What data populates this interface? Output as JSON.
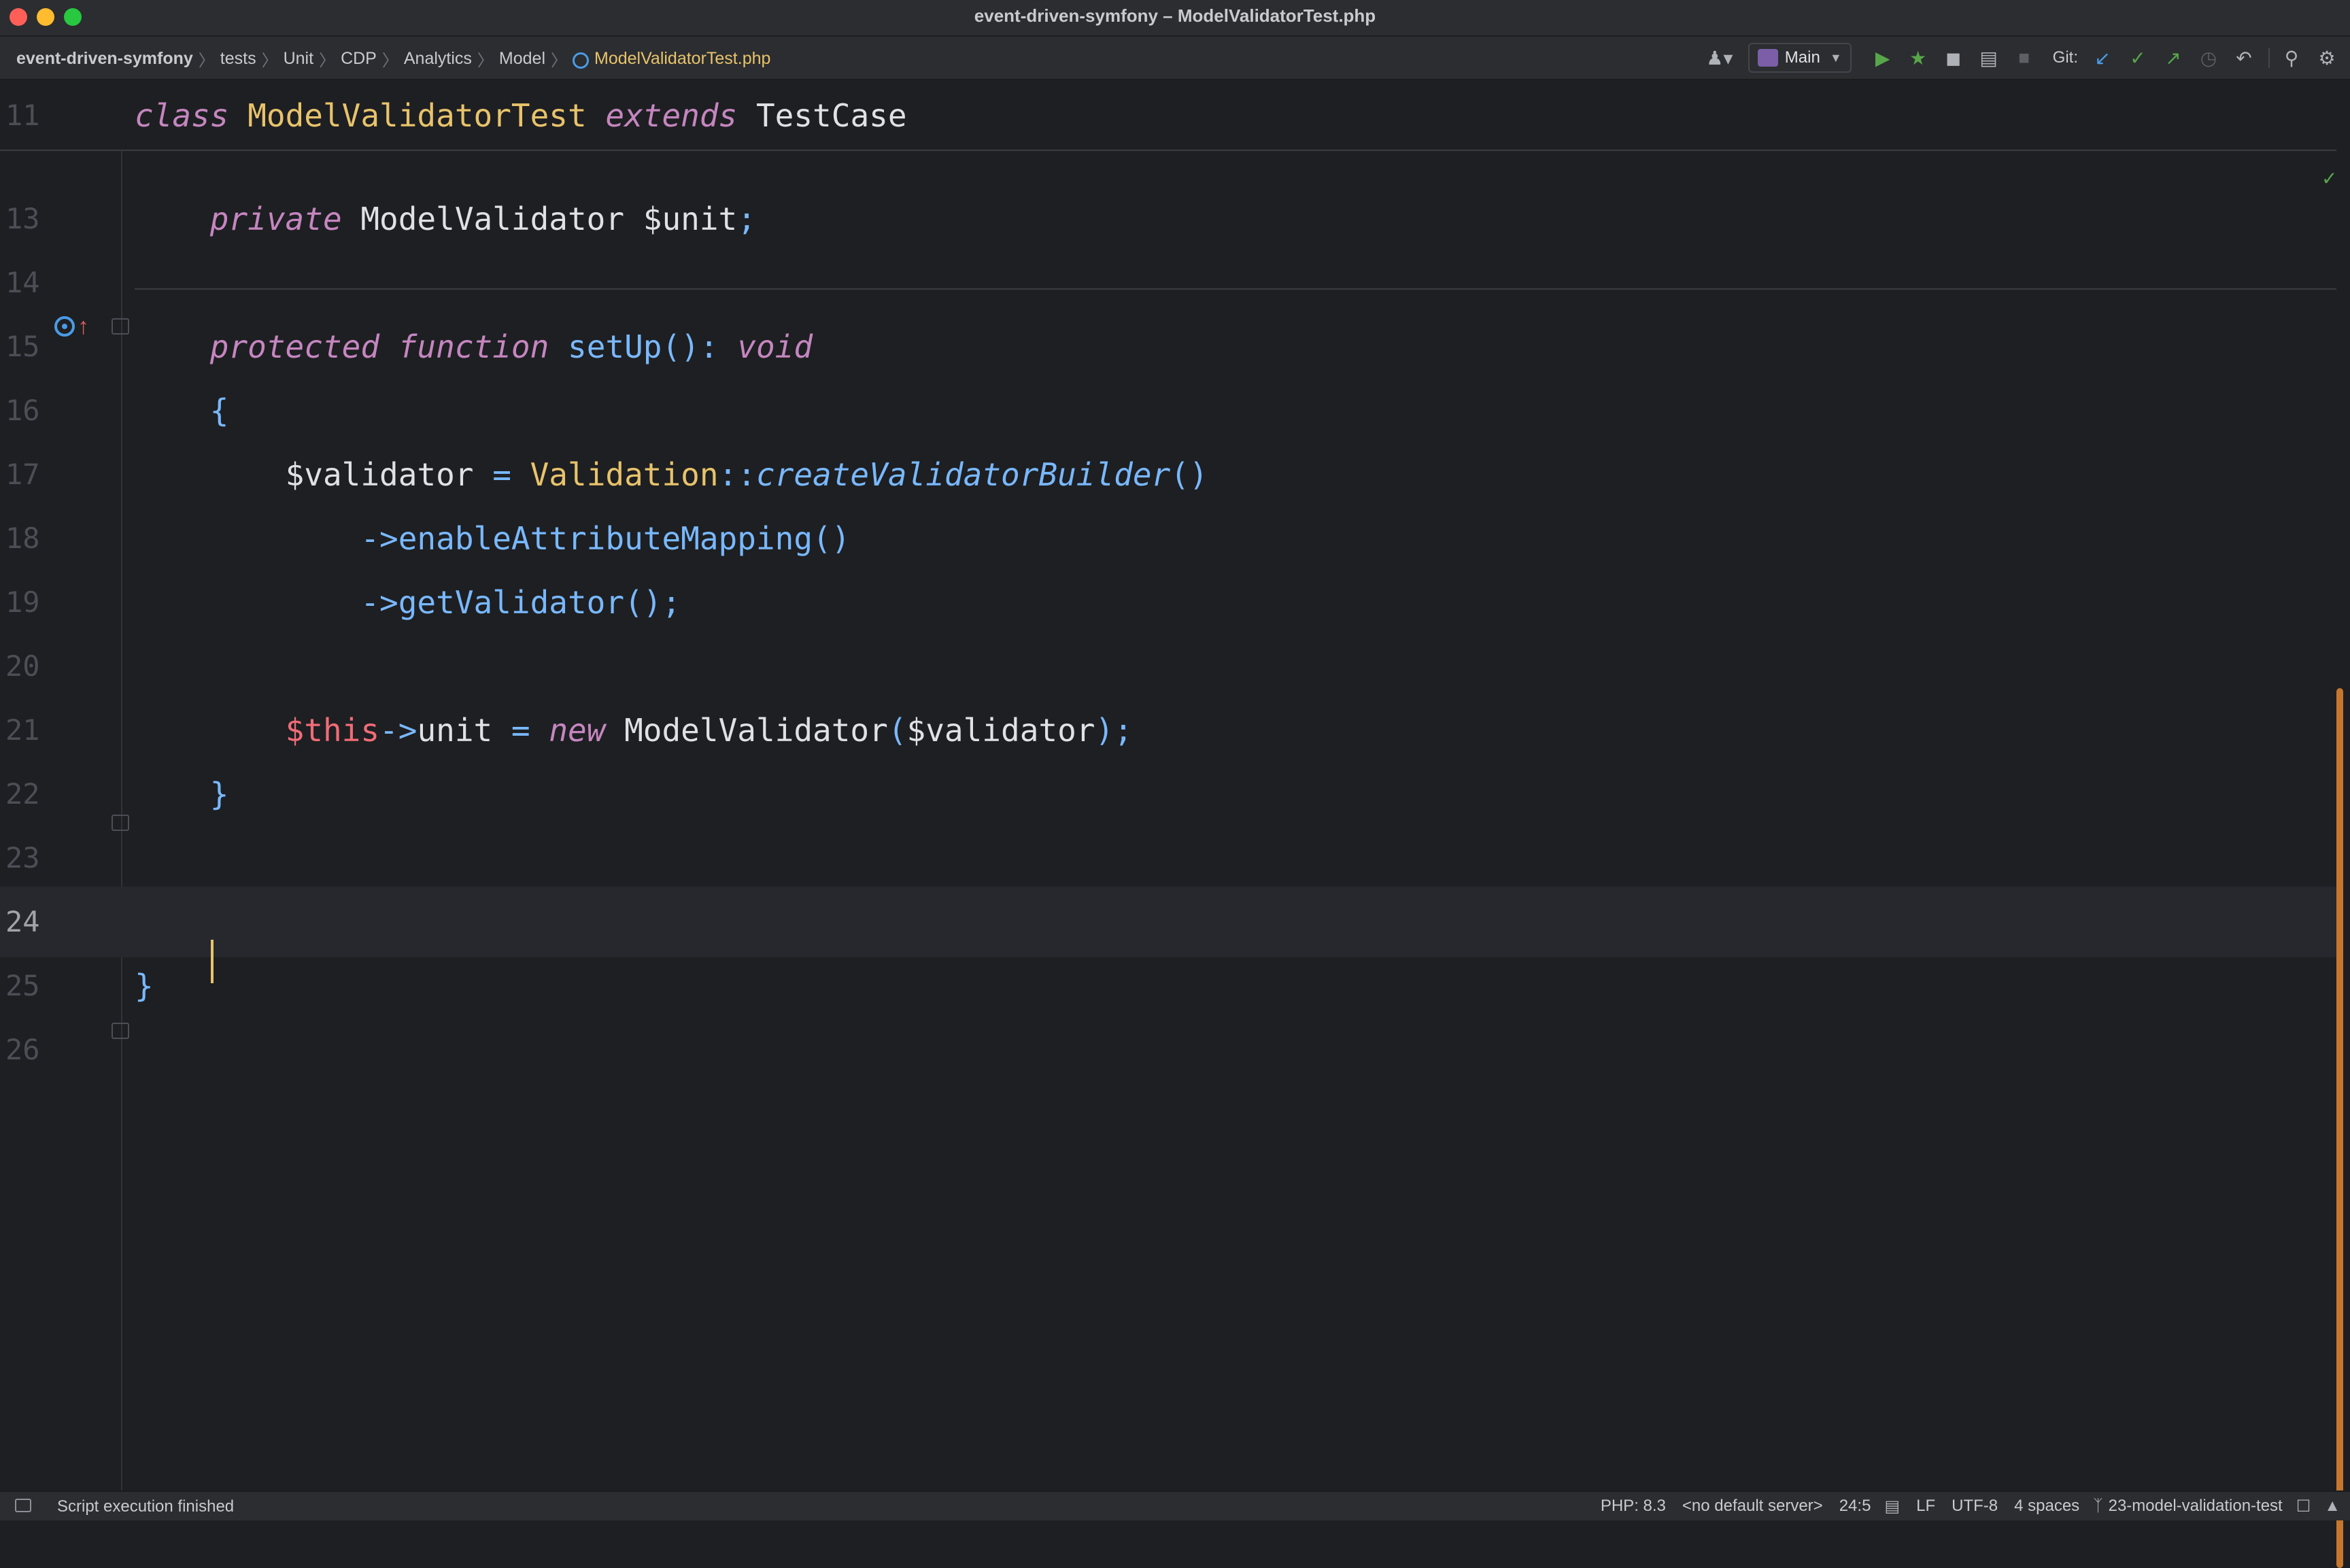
{
  "window": {
    "title": "event-driven-symfony – ModelValidatorTest.php"
  },
  "breadcrumb": {
    "items": [
      "event-driven-symfony",
      "tests",
      "Unit",
      "CDP",
      "Analytics",
      "Model"
    ],
    "file": "ModelValidatorTest.php"
  },
  "toolbar": {
    "run_config": "Main",
    "git_label": "Git:",
    "icons": [
      "user-icon",
      "run-icon",
      "debug-icon",
      "coverage-icon",
      "profile-icon",
      "stop-icon",
      "git-update-icon",
      "git-commit-icon",
      "git-push-icon",
      "git-history-icon",
      "git-rollback-icon",
      "search-icon",
      "settings-icon"
    ]
  },
  "editor": {
    "sticky": {
      "number": "11",
      "tokens": [
        {
          "t": "class",
          "c": "kw2"
        },
        {
          "t": " ",
          "c": "plain"
        },
        {
          "t": "ModelValidatorTest",
          "c": "cls"
        },
        {
          "t": " ",
          "c": "plain"
        },
        {
          "t": "extends",
          "c": "kw2"
        },
        {
          "t": " ",
          "c": "plain"
        },
        {
          "t": "TestCase",
          "c": "plain"
        }
      ]
    },
    "lines": [
      {
        "number": "13",
        "tokens": [
          {
            "t": "    ",
            "c": "plain"
          },
          {
            "t": "private",
            "c": "kw2"
          },
          {
            "t": " ModelValidator $unit",
            "c": "plain"
          },
          {
            "t": ";",
            "c": "punc"
          }
        ]
      },
      {
        "number": "14",
        "tokens": []
      },
      {
        "number": "15",
        "tokens": [
          {
            "t": "    ",
            "c": "plain"
          },
          {
            "t": "protected",
            "c": "kw2"
          },
          {
            "t": " ",
            "c": "plain"
          },
          {
            "t": "function",
            "c": "kw2"
          },
          {
            "t": " ",
            "c": "plain"
          },
          {
            "t": "setUp",
            "c": "fn"
          },
          {
            "t": "()",
            "c": "punc"
          },
          {
            "t": ": ",
            "c": "punc"
          },
          {
            "t": "void",
            "c": "kw2"
          }
        ]
      },
      {
        "number": "16",
        "tokens": [
          {
            "t": "    ",
            "c": "plain"
          },
          {
            "t": "{",
            "c": "punc"
          }
        ]
      },
      {
        "number": "17",
        "tokens": [
          {
            "t": "        ",
            "c": "plain"
          },
          {
            "t": "$validator",
            "c": "plain"
          },
          {
            "t": " = ",
            "c": "op"
          },
          {
            "t": "Validation",
            "c": "cls"
          },
          {
            "t": "::",
            "c": "op"
          },
          {
            "t": "createValidatorBuilder",
            "c": "fn-i"
          },
          {
            "t": "()",
            "c": "punc"
          }
        ]
      },
      {
        "number": "18",
        "tokens": [
          {
            "t": "            ",
            "c": "plain"
          },
          {
            "t": "->",
            "c": "op"
          },
          {
            "t": "enableAttributeMapping",
            "c": "fn"
          },
          {
            "t": "()",
            "c": "punc"
          }
        ]
      },
      {
        "number": "19",
        "tokens": [
          {
            "t": "            ",
            "c": "plain"
          },
          {
            "t": "->",
            "c": "op"
          },
          {
            "t": "getValidator",
            "c": "fn"
          },
          {
            "t": "();",
            "c": "punc"
          }
        ]
      },
      {
        "number": "20",
        "tokens": []
      },
      {
        "number": "21",
        "tokens": [
          {
            "t": "        ",
            "c": "plain"
          },
          {
            "t": "$this",
            "c": "this"
          },
          {
            "t": "->",
            "c": "op"
          },
          {
            "t": "unit",
            "c": "plain"
          },
          {
            "t": " = ",
            "c": "op"
          },
          {
            "t": "new",
            "c": "kw2"
          },
          {
            "t": " ModelValidator",
            "c": "plain"
          },
          {
            "t": "(",
            "c": "punc"
          },
          {
            "t": "$validator",
            "c": "plain"
          },
          {
            "t": ");",
            "c": "punc"
          }
        ]
      },
      {
        "number": "22",
        "tokens": [
          {
            "t": "    ",
            "c": "plain"
          },
          {
            "t": "}",
            "c": "punc"
          }
        ]
      },
      {
        "number": "23",
        "tokens": []
      },
      {
        "number": "24",
        "tokens": [],
        "caret": true
      },
      {
        "number": "25",
        "tokens": [
          {
            "t": "}",
            "c": "punc"
          }
        ]
      },
      {
        "number": "26",
        "tokens": []
      }
    ]
  },
  "statusbar": {
    "message": "Script execution finished",
    "php": "PHP: 8.3",
    "server": "<no default server>",
    "position": "24:5",
    "line_ending": "LF",
    "encoding": "UTF-8",
    "indent": "4 spaces",
    "branch": "23-model-validation-test"
  },
  "colors": {
    "accent": "#e8c36b",
    "scrollbar": "#c6762e",
    "keyword": "#c586c0",
    "function": "#79b8ff",
    "this": "#f06c78"
  }
}
